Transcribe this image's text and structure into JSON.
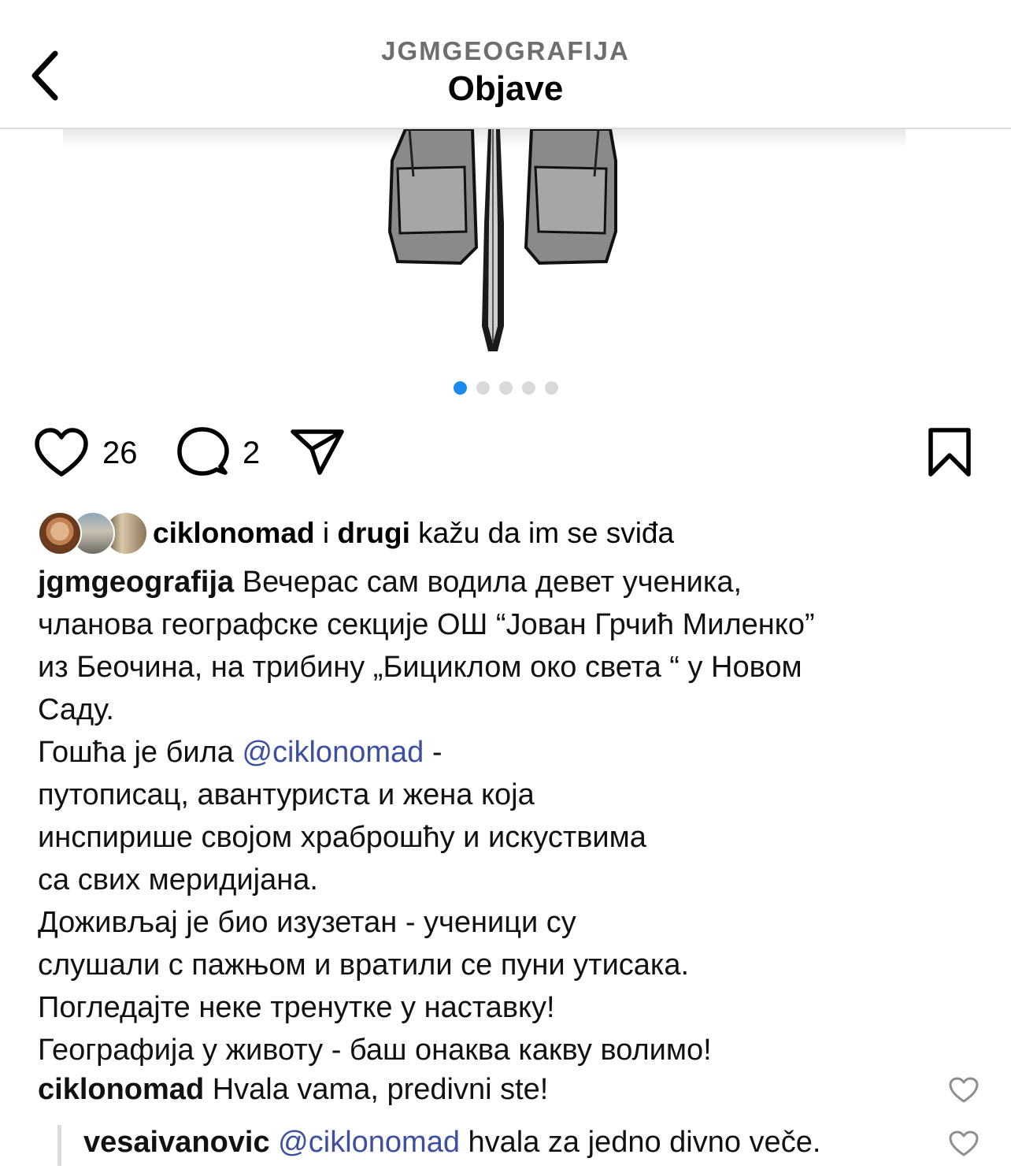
{
  "header": {
    "account": "JGMGEOGRAFIJA",
    "title": "Objave"
  },
  "carousel": {
    "count": 5,
    "active_index": 0
  },
  "actions": {
    "like_count": "26",
    "comment_count": "2"
  },
  "likes": {
    "user": "ciklonomad",
    "connector": " i ",
    "others": "drugi",
    "suffix": " kažu da im se sviđa"
  },
  "caption": {
    "username": "jgmgeografija",
    "lines": [
      "Вечерас сам водила девет ученика,",
      "чланова географске секције ОШ “Јован Грчић Миленко”",
      "из Беочина, на трибину „Бициклом око света “ у Новом",
      "Саду.",
      "Гошћа је била ",
      "@ciklonomad",
      " -",
      "путописац, авантуриста и жена која",
      "инспирише својом храброшћу и искуствима",
      "са свих меридијана.",
      "Доживљај је био изузетан - ученици су",
      "слушали с пажњом и вратили се пуни утисака.",
      "Погледајте неке тренутке у наставку!",
      "Географија у животу - баш онаква какву волимо!"
    ]
  },
  "comments": [
    {
      "username": "ciklonomad",
      "text": "Hvala vama, predivni ste!"
    },
    {
      "username": "vesaivanovic",
      "mention": "@ciklonomad",
      "text": " hvala za jedno divno veče."
    }
  ],
  "colors": {
    "accent": "#1a8cf0",
    "mention": "#3d4fa0",
    "subtitle": "#6e6e6e"
  },
  "icons": [
    "back-chevron-icon",
    "heart-icon",
    "comment-icon",
    "share-icon",
    "bookmark-icon"
  ]
}
